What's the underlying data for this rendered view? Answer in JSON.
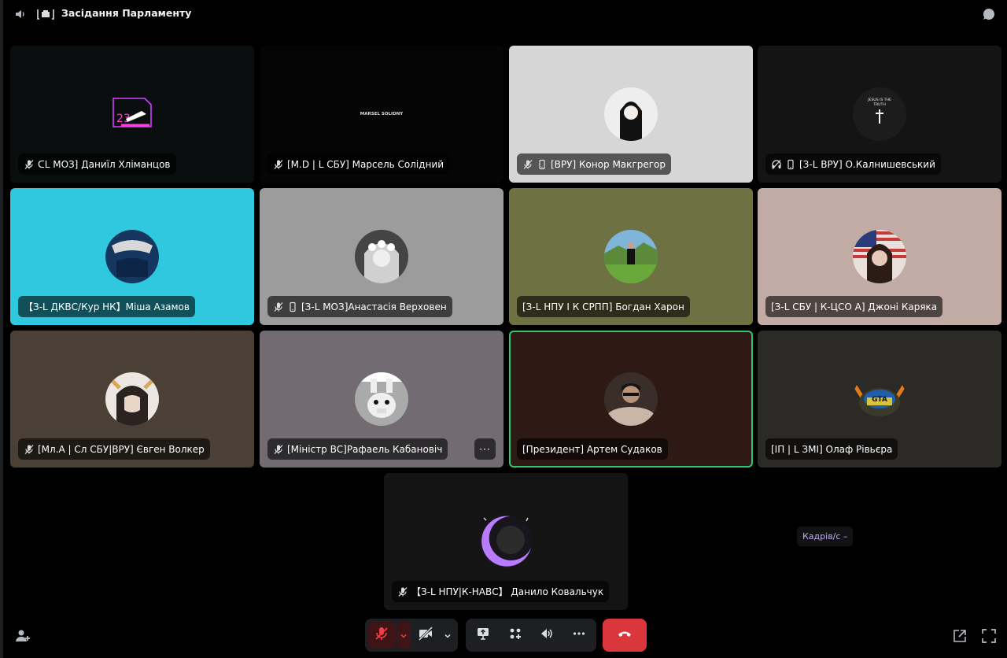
{
  "window": {
    "title": "Засідання Парламенту"
  },
  "tiles": [
    {
      "name": "ᑕL МОЗ⁆ Даниїл Хліманцов",
      "bg": "#0b0e0e",
      "avatar_bg": "#0b0e0e",
      "muted": true,
      "phone": false,
      "video_off": false
    },
    {
      "name": "[M.D | L СБУ] Марсель Солідний",
      "bg": "#050505",
      "avatar_bg": "#050505",
      "avatar_text": "MARSEL SOLIDNY",
      "muted": true,
      "phone": false,
      "video_off": false
    },
    {
      "name": "[ВРУ] Конор Макгрегор",
      "bg": "#d6d6d6",
      "avatar_bg": "#e8e8e8",
      "muted": true,
      "phone": true,
      "video_off": false
    },
    {
      "name": "[З-L ВРУ] О.Калнишевський",
      "bg": "#141414",
      "avatar_bg": "#1c1c1c",
      "avatar_text": "JESUS IS THE TRUTH",
      "muted": false,
      "phone": true,
      "video_off": true
    },
    {
      "name": "【З-L ДКВС/Кур НК】Міша Азамов",
      "bg": "#2fc8de",
      "avatar_bg": "#15365e",
      "muted": false,
      "phone": false,
      "video_off": false
    },
    {
      "name": "[З-L МОЗ]Анастасія Верховен",
      "bg": "#9c9c9c",
      "avatar_bg": "#d7d7d7",
      "muted": true,
      "phone": true,
      "video_off": false
    },
    {
      "name": "[З-L НПУ І К СРПП] Богдан Харон",
      "bg": "#6e7243",
      "avatar_bg": "#6a9a3c",
      "muted": false,
      "phone": false,
      "video_off": false
    },
    {
      "name": "[З-L СБУ | К-ЦСО А] Джоні Каряка",
      "bg": "#c2aaa5",
      "avatar_bg": "#e9e0dc",
      "muted": false,
      "phone": false,
      "video_off": false
    },
    {
      "name": "[Мл.А | Сл СБУ|ВРУ] Євген Волкер",
      "bg": "#4a4036",
      "avatar_bg": "#6a5a4a",
      "muted": true,
      "phone": false,
      "video_off": false
    },
    {
      "name": "[Міністр ВС]Рафаель Кабановіч",
      "bg": "#726b72",
      "avatar_bg": "#b8b8b8",
      "muted": true,
      "phone": false,
      "video_off": false,
      "more": "···"
    },
    {
      "name": "[Президент] Артем Судаков",
      "bg": "#2f1914",
      "avatar_bg": "#a88a78",
      "muted": false,
      "phone": false,
      "video_off": false,
      "speaking": true
    },
    {
      "name": "[ІП | L ЗМІ] Олаф Рівьєра",
      "bg": "#2b2a27",
      "avatar_bg": "#2b2a27",
      "avatar_text": "GTA",
      "muted": false,
      "phone": false,
      "video_off": false
    },
    {
      "name": "【З-L НПУ|К-НАВС】 Данило Ковальчук",
      "bg": "#141414",
      "avatar_bg": "#18161c",
      "muted": true,
      "phone": false,
      "video_off": false
    }
  ],
  "fps_label": "Кадрів/с –",
  "colors": {
    "accent_speaking": "#2dc770",
    "hangup": "#da373c",
    "mute_red": "#f23f43"
  },
  "icons": {
    "voice": "speaker-icon",
    "channel": "stage-icon",
    "chat": "chat-bubble-icon",
    "invite": "add-person-icon",
    "mic": "mic-muted-icon",
    "camera": "camera-off-icon",
    "share": "screen-share-icon",
    "activity": "activity-icon",
    "soundboard": "soundboard-icon",
    "more": "more-icon",
    "hangup": "hang-up-icon",
    "popout": "pop-out-icon",
    "fullscreen": "fullscreen-icon"
  }
}
